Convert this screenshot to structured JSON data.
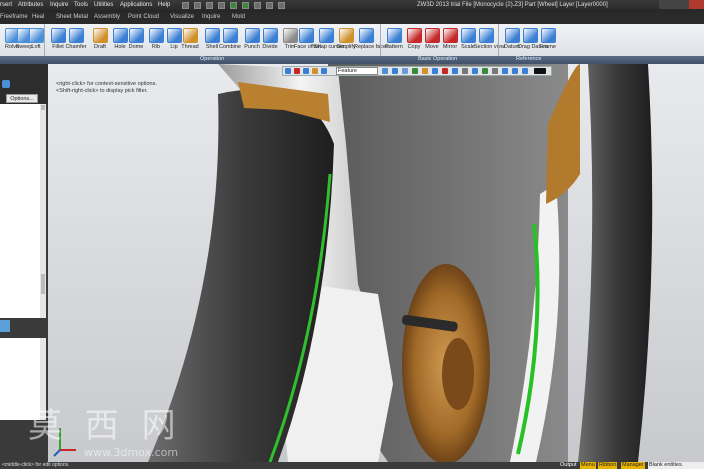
{
  "menubar": {
    "items": [
      "rsert",
      "Attributes",
      "Inquire",
      "Tools",
      "Utilities",
      "Applications",
      "Help"
    ],
    "title": "ZW3D 2013 trial        File [Monocycle (2).Z3]  Part [Wheel]  Layer [Layer0000]"
  },
  "tabs": [
    "Freeframe",
    "Heal",
    "Sheet Metal",
    "Assembly",
    "Point Cloud",
    "Visualize",
    "Inquire",
    "Mold"
  ],
  "ribbon": {
    "buttons": [
      {
        "label": "Rolve",
        "icon": "revolve-icon",
        "color": "#4a8fd8"
      },
      {
        "label": "Sweep",
        "icon": "sweep-icon",
        "color": "#4a8fd8"
      },
      {
        "label": "Loft",
        "icon": "loft-icon",
        "color": "#4a8fd8"
      },
      {
        "label": "Fillet",
        "icon": "fillet-icon",
        "color": "#3b7fd4"
      },
      {
        "label": "Chamfer",
        "icon": "chamfer-icon",
        "color": "#3b7fd4"
      },
      {
        "label": "Draft",
        "icon": "draft-icon",
        "color": "#d0902a"
      },
      {
        "label": "Hole",
        "icon": "hole-icon",
        "color": "#3b7fd4"
      },
      {
        "label": "Dome",
        "icon": "dome-icon",
        "color": "#3b7fd4"
      },
      {
        "label": "Rib",
        "icon": "rib-icon",
        "color": "#3b7fd4"
      },
      {
        "label": "Lip",
        "icon": "lip-icon",
        "color": "#3b7fd4"
      },
      {
        "label": "Thread",
        "icon": "thread-icon",
        "color": "#d0902a"
      },
      {
        "label": "Shell",
        "icon": "shell-icon",
        "color": "#3b7fd4"
      },
      {
        "label": "Combine",
        "icon": "combine-icon",
        "color": "#3b7fd4"
      },
      {
        "label": "Punch",
        "icon": "punch-icon",
        "color": "#3b7fd4"
      },
      {
        "label": "Divide",
        "icon": "divide-icon",
        "color": "#3b7fd4"
      },
      {
        "label": "Trim",
        "icon": "trim-icon",
        "color": "#8a8a8a"
      },
      {
        "label": "Face offset",
        "icon": "face-offset-icon",
        "color": "#3b7fd4"
      },
      {
        "label": "Shap curves",
        "icon": "shape-curves-icon",
        "color": "#3b7fd4"
      },
      {
        "label": "Simplify",
        "icon": "simplify-icon",
        "color": "#d0902a"
      },
      {
        "label": "Replace faces",
        "icon": "replace-faces-icon",
        "color": "#3b7fd4"
      },
      {
        "label": "Pattern",
        "icon": "pattern-icon",
        "color": "#3b7fd4"
      },
      {
        "label": "Copy",
        "icon": "copy-icon",
        "color": "#c62828"
      },
      {
        "label": "Move",
        "icon": "move-icon",
        "color": "#c62828"
      },
      {
        "label": "Mirror",
        "icon": "mirror-icon",
        "color": "#c62828"
      },
      {
        "label": "Scale",
        "icon": "scale-icon",
        "color": "#3b7fd4"
      },
      {
        "label": "Section view",
        "icon": "section-view-icon",
        "color": "#3b7fd4"
      },
      {
        "label": "Datum",
        "icon": "datum-icon",
        "color": "#3b7fd4"
      },
      {
        "label": "Drag Datum",
        "icon": "drag-datum-icon",
        "color": "#3b7fd4"
      },
      {
        "label": "Frame",
        "icon": "frame-icon",
        "color": "#3b7fd4"
      }
    ],
    "groups": [
      "Operation",
      "Basic Operation",
      "Reference"
    ]
  },
  "left_panel": {
    "options_label": "Options..."
  },
  "viewport": {
    "hint1": "<right-click> for context-sensitive options.",
    "hint2": "<Shift-right-click> to display pick filter.",
    "filter_value": "Feature"
  },
  "statusbar": {
    "message": "<middle-click> for edit options.",
    "output_label": "Output",
    "tabs": [
      "Menu",
      "Ribbon",
      "Manager"
    ],
    "right_text": "Blank entities."
  },
  "watermark": {
    "text": "莫 西 网",
    "url": "www.3dmox.com"
  }
}
